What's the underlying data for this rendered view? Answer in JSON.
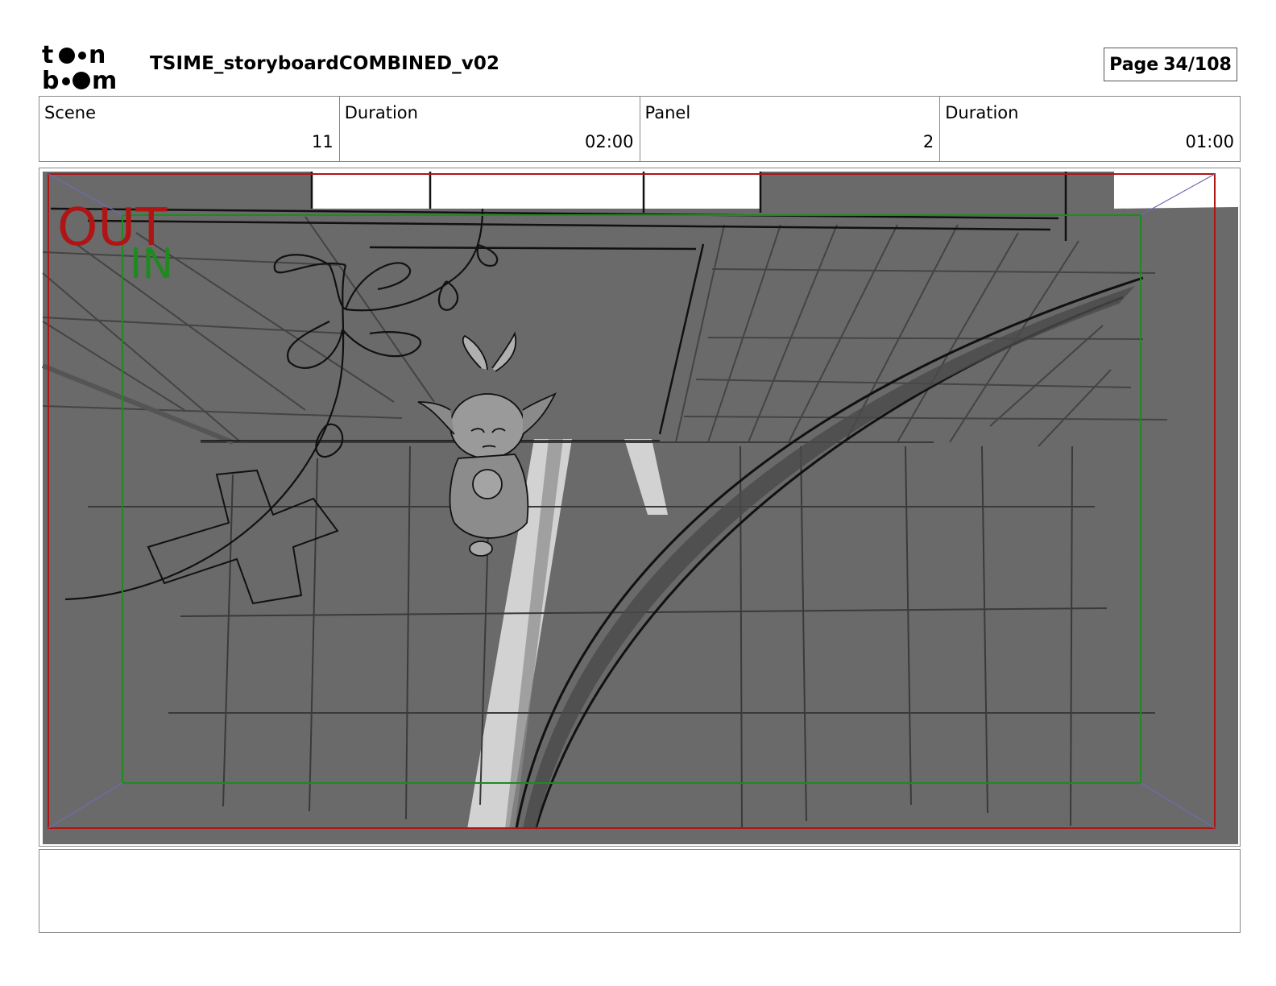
{
  "header": {
    "logo": {
      "brand": "toon boom",
      "icon": "toon-boom-logo"
    },
    "document_title": "TSIME_storyboardCOMBINED_v02",
    "page": {
      "label": "Page",
      "value": "34/108"
    }
  },
  "info": {
    "scene_label": "Scene",
    "scene_value": "11",
    "scene_duration_label": "Duration",
    "scene_duration_value": "02:00",
    "panel_label": "Panel",
    "panel_value": "2",
    "panel_duration_label": "Duration",
    "panel_duration_value": "01:00"
  },
  "panel_image": {
    "out_label": "OUT",
    "in_label": "IN",
    "colors": {
      "out_frame": "#b01515",
      "in_frame": "#1f8a1f",
      "background": "#6a6a6a",
      "light_patch": "#d2d2d2"
    }
  },
  "notes": {
    "text": ""
  }
}
